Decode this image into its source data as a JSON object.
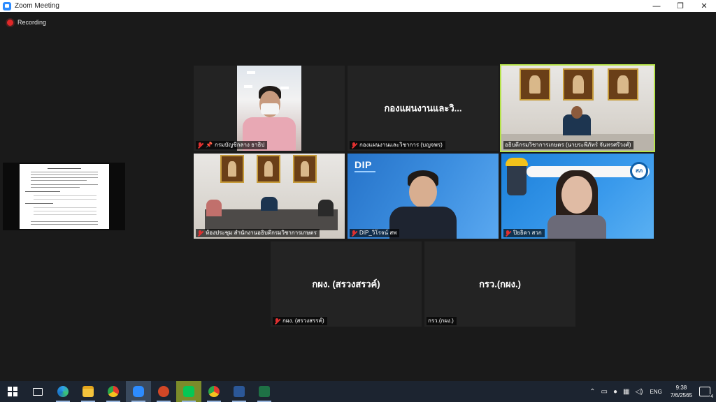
{
  "window": {
    "title": "Zoom Meeting",
    "minimize": "—",
    "restore": "❐",
    "close": "✕"
  },
  "recording": {
    "label": "Recording"
  },
  "tiles": [
    {
      "id": "t1",
      "name_tag": "กรมบัญชีกลาง ธาธิป",
      "pinned": true
    },
    {
      "id": "t2",
      "display_name": "กองแผนงานและวิ...",
      "name_tag": "กองแผนงานและวิชาการ (บญจพร)"
    },
    {
      "id": "t3",
      "name_tag": "อธิบดีกรมวิชาการเกษตร (นายระพีภัทร์ จันทรศรีวงศ์)"
    },
    {
      "id": "t4",
      "name_tag": "ห้องประชุม สำนักงานอธิบดีกรมวิชาการเกษตร"
    },
    {
      "id": "t5",
      "logo": "DIP",
      "name_tag": "DIP_วิโรจน์ สพ"
    },
    {
      "id": "t6",
      "banner_logo": "สภ",
      "name_tag": "ปิยธิดา สวก"
    },
    {
      "id": "t7",
      "display_name": "กผง. (สรวงสรวค์)",
      "name_tag": "กผง. (สรวงสรรค์)"
    },
    {
      "id": "t8",
      "display_name": "กรว.(กผง.)",
      "name_tag": "กรว.(กผง.)"
    }
  ],
  "colors": {
    "active_speaker": "#b6e34a",
    "muted": "#e03030",
    "recording": "#e02828"
  },
  "taskbar": {
    "apps": [
      "windows-start",
      "task-view",
      "edge",
      "file-explorer",
      "chrome",
      "zoom",
      "powerpoint",
      "line",
      "chrome-profile",
      "word",
      "excel"
    ],
    "language": "ENG",
    "time": "9:38",
    "date": "7/6/2565",
    "notifications": "4"
  }
}
